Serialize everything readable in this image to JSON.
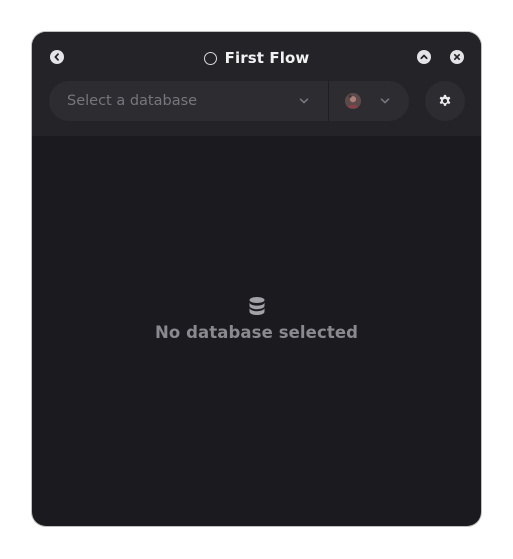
{
  "window": {
    "title": "First Flow"
  },
  "titlebar": {
    "back_icon": "chevron-left-icon",
    "collapse_icon": "chevron-up-icon",
    "close_icon": "close-icon",
    "status_icon": "status-ring-icon"
  },
  "toolbar": {
    "database_select": {
      "placeholder": "Select a database",
      "icon": "chevron-down-icon"
    },
    "user_select": {
      "icon": "chevron-down-icon",
      "avatar": "avatar"
    },
    "settings_icon": "gear-icon"
  },
  "empty_state": {
    "icon": "database-icon",
    "message": "No database selected"
  },
  "colors": {
    "window_bg": "#1b1a1e",
    "header_bg": "#242328",
    "control_bg": "#2d2c31",
    "title_text": "#f1f1f2",
    "placeholder_text": "#77767c",
    "empty_text": "#8a898f"
  }
}
